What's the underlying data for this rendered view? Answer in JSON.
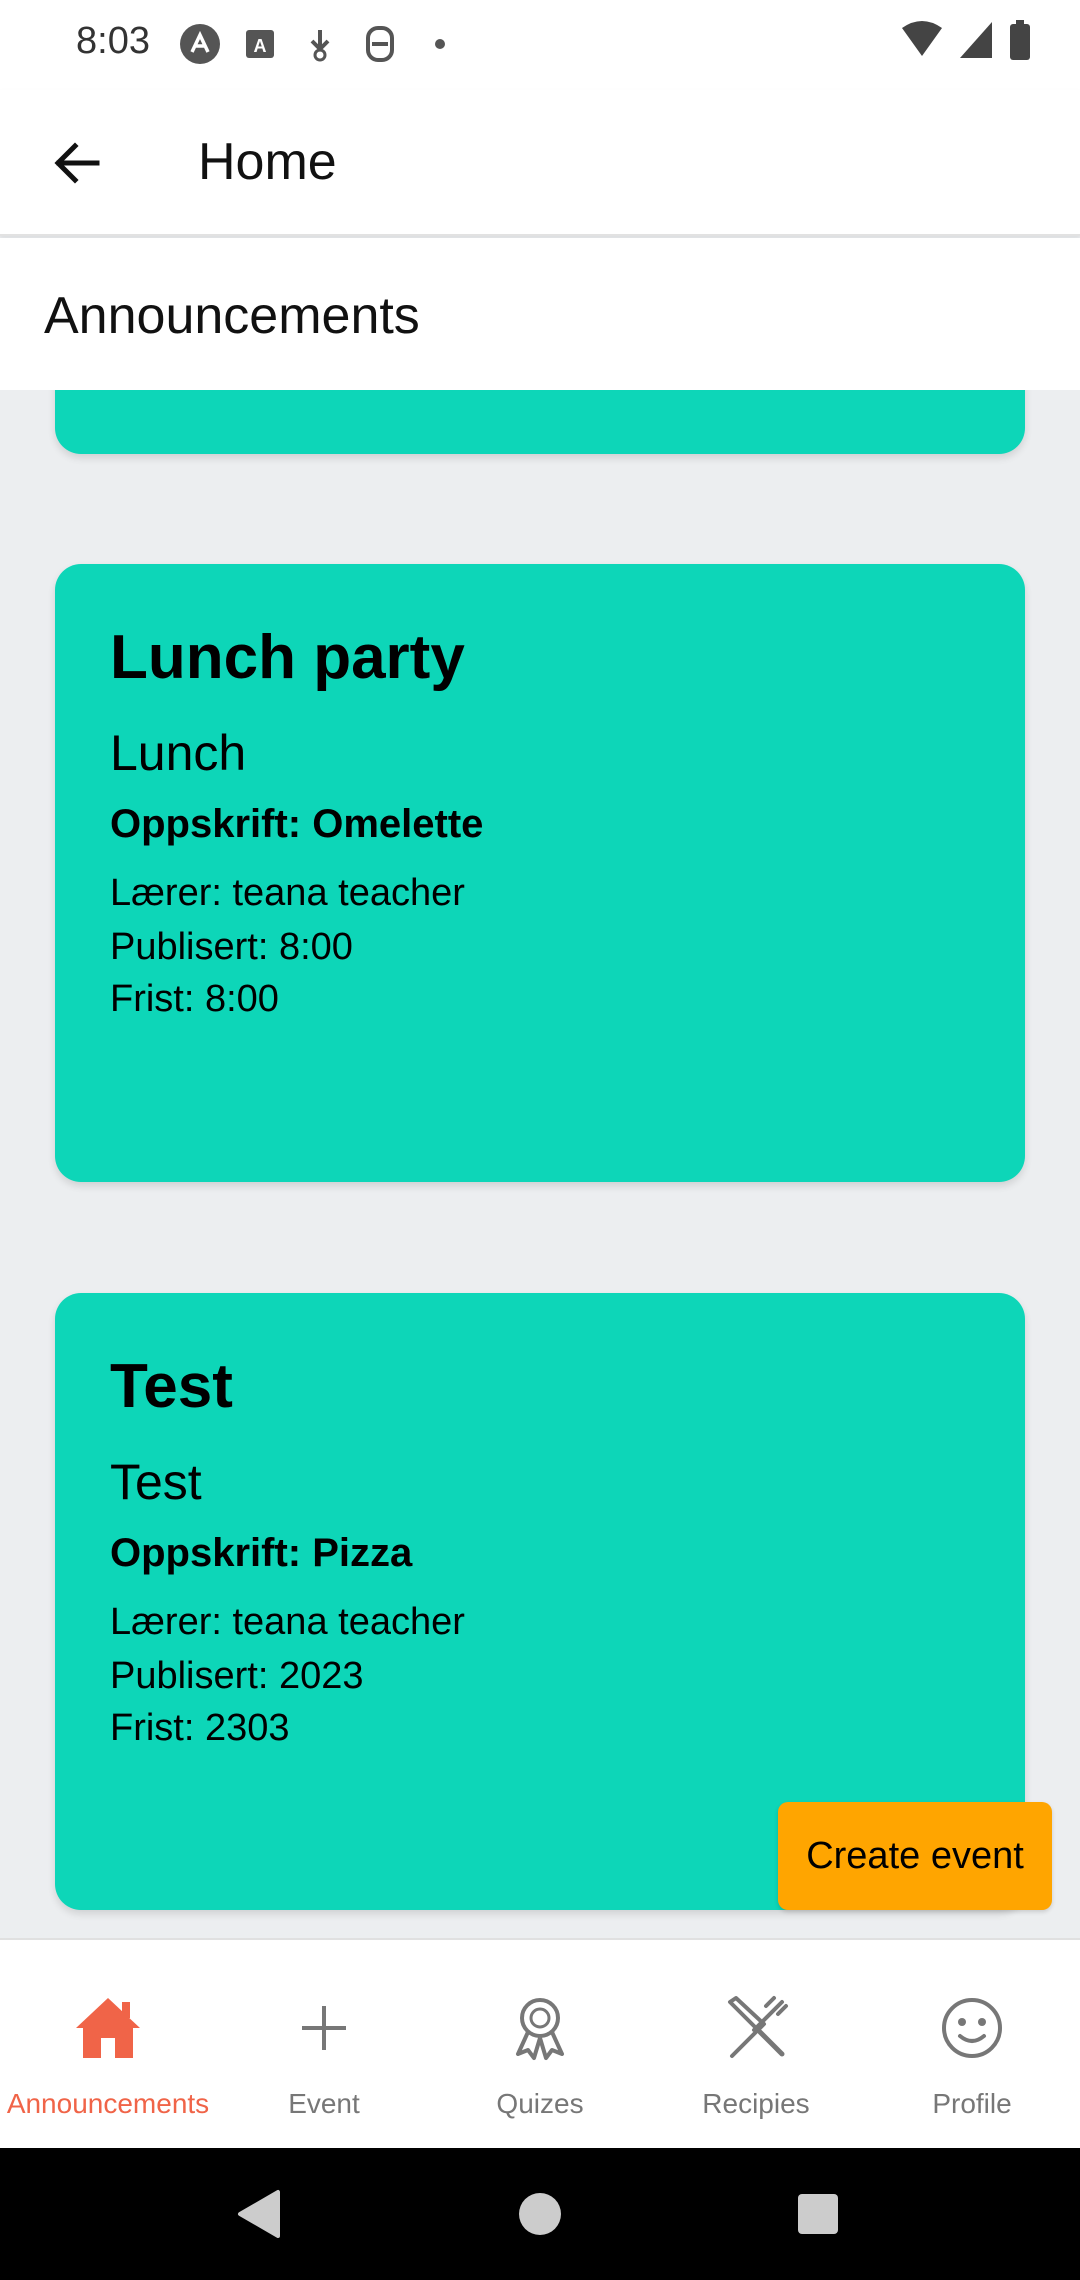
{
  "status_bar": {
    "time": "8:03",
    "icons": [
      "app-a-icon",
      "app-text-icon",
      "download-icon",
      "sync-icon",
      "dot-icon",
      "wifi-icon",
      "signal-icon",
      "battery-icon"
    ]
  },
  "app_bar": {
    "title": "Home",
    "back_icon": "arrow-left-icon"
  },
  "section": {
    "title": "Announcements"
  },
  "cards": [
    {
      "title": "Lunch party",
      "subtitle": "Lunch",
      "recipe": "Oppskrift: Omelette",
      "teacher": "Lærer: teana teacher",
      "published": "Publisert: 8:00",
      "deadline": "Frist: 8:00"
    },
    {
      "title": "Test",
      "subtitle": "Test",
      "recipe": "Oppskrift: Pizza",
      "teacher": "Lærer: teana teacher",
      "published": "Publisert: 2023",
      "deadline": "Frist: 2303"
    }
  ],
  "fab": {
    "label": "Create event"
  },
  "bottom_nav": [
    {
      "label": "Announcements",
      "icon": "home-icon",
      "active": true
    },
    {
      "label": "Event",
      "icon": "plus-icon",
      "active": false
    },
    {
      "label": "Quizes",
      "icon": "award-icon",
      "active": false
    },
    {
      "label": "Recipies",
      "icon": "utensils-icon",
      "active": false
    },
    {
      "label": "Profile",
      "icon": "smile-icon",
      "active": false
    }
  ],
  "colors": {
    "card": "#0dd6b8",
    "fab": "#ffa500",
    "active_nav": "#f06448",
    "background": "#eceef0"
  }
}
